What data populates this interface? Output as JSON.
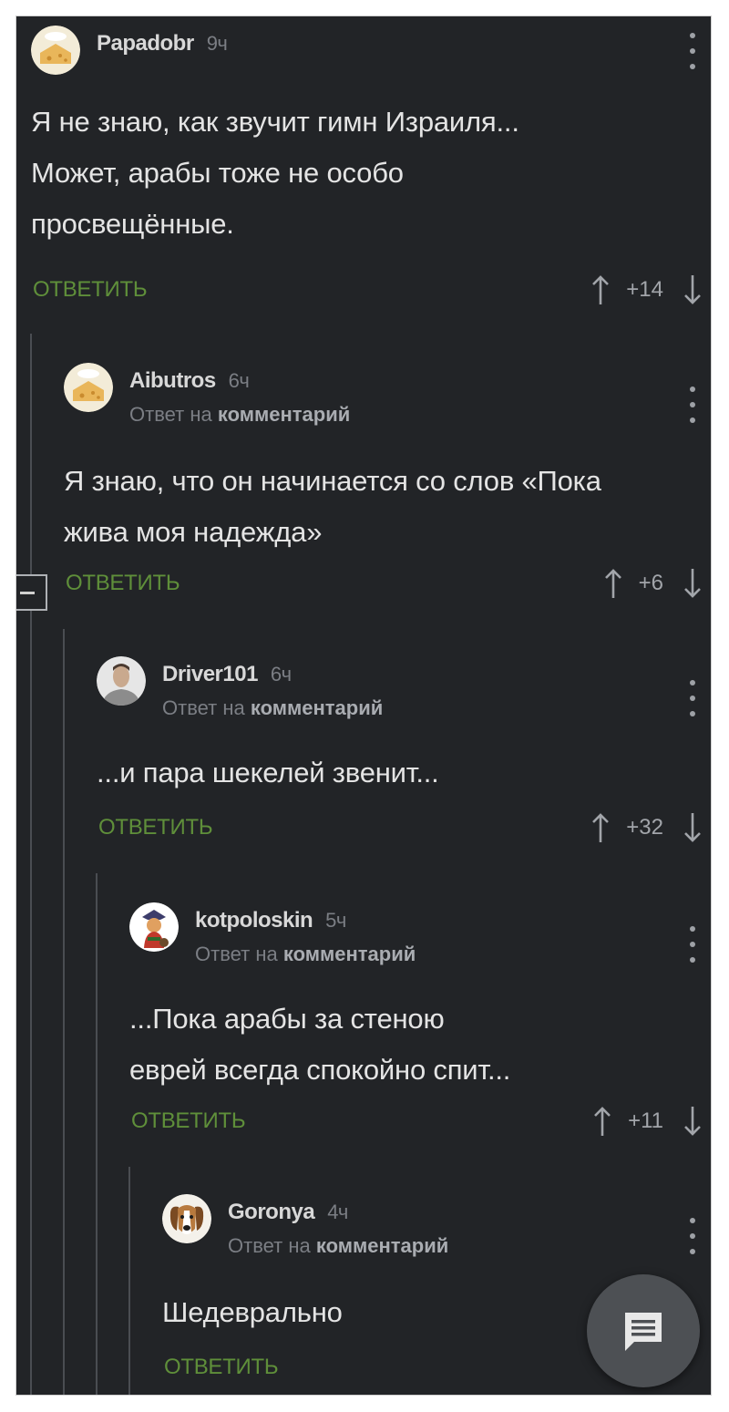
{
  "reply_label": "ОТВЕТИТЬ",
  "reply_prefix": "Ответ на",
  "reply_target": "комментарий",
  "colors": {
    "background": "#222427",
    "username": "#d8d8d8",
    "reply_action": "#5f8f3a",
    "meta": "#7b7e84"
  },
  "comments": [
    {
      "username": "Papadobr",
      "time": "9ч",
      "avatar": "cheese-avatar",
      "text": "Я не знаю, как звучит гимн Израиля...\nМожет, арабы тоже не особо\nпросвещённые.",
      "score": "+14"
    },
    {
      "username": "Aibutros",
      "time": "6ч",
      "avatar": "cheese-avatar",
      "text": "Я знаю, что он начинается со слов «Пока\nжива моя надежда»",
      "score": "+6"
    },
    {
      "username": "Driver101",
      "time": "6ч",
      "avatar": "faceless-man-avatar",
      "text": "...и пара шекелей звенит...",
      "score": "+32"
    },
    {
      "username": "kotpoloskin",
      "time": "5ч",
      "avatar": "cartoon-character-avatar",
      "text": "...Пока арабы за стеною\nеврей всегда спокойно спит...",
      "score": "+11"
    },
    {
      "username": "Goronya",
      "time": "4ч",
      "avatar": "beagle-dog-avatar",
      "text": "Шедеврально",
      "score": ""
    }
  ],
  "fab": {
    "icon": "comment-icon"
  }
}
